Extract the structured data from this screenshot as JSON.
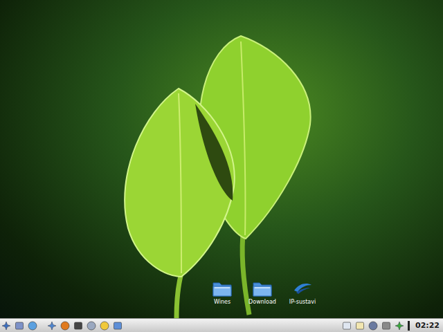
{
  "desktop": {
    "icons": [
      {
        "label": "Wines",
        "kind": "folder"
      },
      {
        "label": "Download",
        "kind": "folder"
      },
      {
        "label": "IP-sustavi",
        "kind": "link"
      }
    ]
  },
  "taskbar": {
    "clock": "02:22"
  }
}
